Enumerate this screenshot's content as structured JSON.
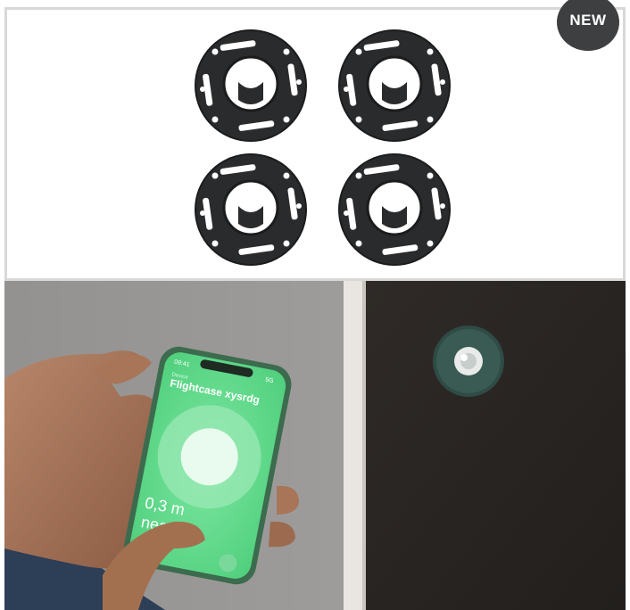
{
  "badge": {
    "label": "NEW"
  },
  "product": {
    "item_name": "mounting-ring",
    "ring_count": 4
  },
  "phone": {
    "time": "09:41",
    "status_right": "5G",
    "small_label": "Device",
    "title": "Flightcase xysrdg",
    "distance": "0,3 m",
    "proximity": "nearby",
    "left_button_icon": "play-icon",
    "right_button_icon": "stop-icon"
  },
  "colors": {
    "badge_bg": "#3d3f41",
    "screen_green": "#5fdc8a",
    "phone_frame": "#3c6b4e",
    "case_surface": "#2b2724",
    "ring_color": "#2a2b2d"
  }
}
